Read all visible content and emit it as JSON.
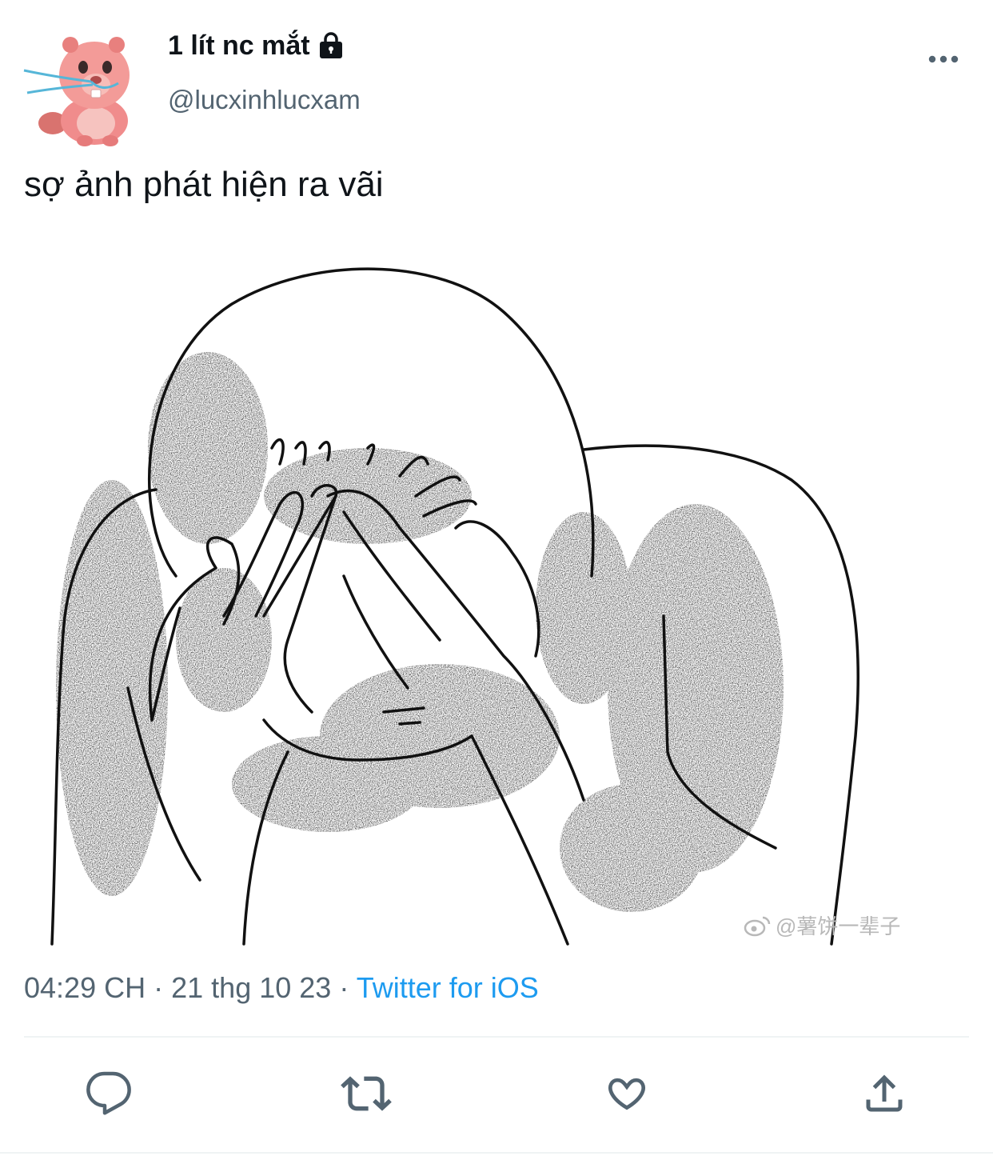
{
  "user": {
    "display_name": "1 lít nc mắt",
    "handle": "@lucxinhlucxam",
    "protected_icon": "lock-icon",
    "avatar": "pink-beaver-avatar"
  },
  "tweet": {
    "text": "sợ ảnh phát hiện ra vãi",
    "media_watermark": "@薯饼一辈子",
    "time": "04:29 CH",
    "date": "21 thg 10 23",
    "separator": "·",
    "source": "Twitter for iOS"
  },
  "actions": [
    {
      "name": "reply",
      "icon": "reply-icon"
    },
    {
      "name": "retweet",
      "icon": "retweet-icon"
    },
    {
      "name": "like",
      "icon": "heart-icon"
    },
    {
      "name": "share",
      "icon": "share-icon"
    }
  ],
  "colors": {
    "text_primary": "#0f1419",
    "text_secondary": "#536471",
    "link": "#1d9bf0",
    "icon": "#536471",
    "divider": "#eff3f4"
  }
}
